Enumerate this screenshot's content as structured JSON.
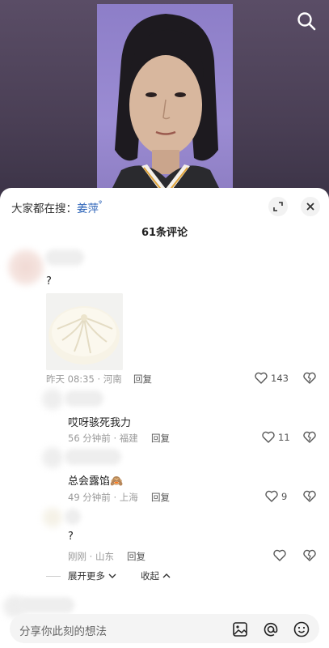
{
  "hot_search": {
    "prefix": "大家都在搜：",
    "keyword": "姜萍"
  },
  "comments_title": "61条评论",
  "comments": [
    {
      "text": "?",
      "time": "昨天 08:35",
      "location": "河南",
      "reply": "回复",
      "likes": "143"
    },
    {
      "text": "哎呀骇死我力",
      "time": "56 分钟前",
      "location": "福建",
      "reply": "回复",
      "likes": "11"
    },
    {
      "text": "总会露馅",
      "emoji": "🙈",
      "time": "49 分钟前",
      "location": "上海",
      "reply": "回复",
      "likes": "9"
    },
    {
      "text": "?",
      "time": "刚刚",
      "location": "山东",
      "reply": "回复",
      "likes": ""
    }
  ],
  "expand_more": "展开更多",
  "collapse": "收起",
  "input_placeholder": "分享你此刻的想法",
  "colors": {
    "link": "#2c63b8",
    "sheet": "#ffffff",
    "video_bg": "#4a3f55"
  }
}
